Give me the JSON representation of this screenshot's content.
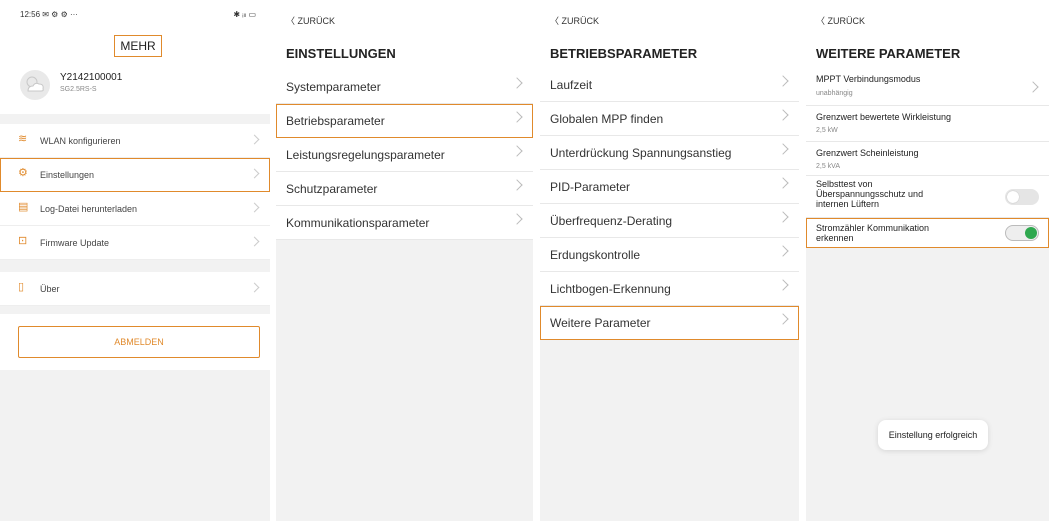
{
  "panel1": {
    "status_left": "12:56 ✉ ⚙ ⚙ ···",
    "status_right": "✱ ᵢₗₗ ▭",
    "title": "MEHR",
    "device_id": "Y2142100001",
    "device_model": "SG2.5RS-S",
    "menu": [
      {
        "label": "WLAN konfigurieren",
        "icon": "router-icon"
      },
      {
        "label": "Einstellungen",
        "icon": "gear-icon"
      },
      {
        "label": "Log-Datei herunterladen",
        "icon": "document-icon"
      },
      {
        "label": "Firmware Update",
        "icon": "update-icon"
      },
      {
        "label": "Über",
        "icon": "info-icon"
      }
    ],
    "logout_label": "ABMELDEN"
  },
  "panel2": {
    "back": "ZURÜCK",
    "title": "EINSTELLUNGEN",
    "items": [
      "Systemparameter",
      "Betriebsparameter",
      "Leistungsregelungsparameter",
      "Schutzparameter",
      "Kommunikationsparameter"
    ]
  },
  "panel3": {
    "back": "ZURÜCK",
    "title": "BETRIEBSPARAMETER",
    "items": [
      "Laufzeit",
      "Globalen MPP finden",
      "Unterdrückung Spannungsanstieg",
      "PID-Parameter",
      "Überfrequenz-Derating",
      "Erdungskontrolle",
      "Lichtbogen-Erkennung",
      "Weitere Parameter"
    ]
  },
  "panel4": {
    "back": "ZURÜCK",
    "title": "WEITERE PARAMETER",
    "items": [
      {
        "label": "MPPT Verbindungsmodus",
        "value": "unabhängig"
      },
      {
        "label": "Grenzwert bewertete Wirkleistung",
        "value": "2,5 kW"
      },
      {
        "label": "Grenzwert Scheinleistung",
        "value": "2,5 kVA"
      },
      {
        "label": "Selbsttest von Überspannungsschutz und internen Lüftern",
        "toggle": false
      },
      {
        "label": "Stromzähler Kommunikation erkennen",
        "toggle": true
      }
    ],
    "toast": "Einstellung erfolgreich"
  },
  "accent_color": "#e08a2c",
  "toggle_on_color": "#2fa84f"
}
